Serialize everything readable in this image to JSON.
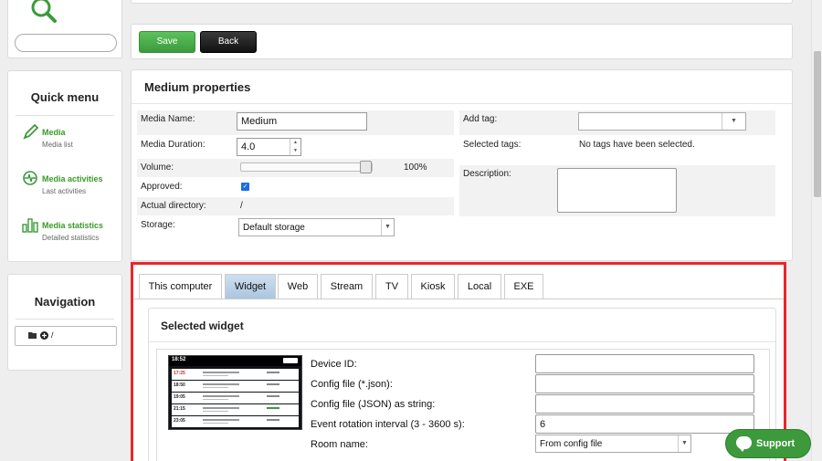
{
  "colors": {
    "accent_green": "#3c9a3c",
    "highlight_red": "#e8262c",
    "tab_active": "#aac6de"
  },
  "logo": {
    "icon": "search-icon"
  },
  "search": {
    "placeholder": ""
  },
  "quick_menu": {
    "title": "Quick menu",
    "items": [
      {
        "label": "Media",
        "sub": "Media list",
        "icon": "pencil-icon"
      },
      {
        "label": "Media activities",
        "sub": "Last activities",
        "icon": "activity-icon"
      },
      {
        "label": "Media statistics",
        "sub": "Detailed statistics",
        "icon": "bar-chart-icon"
      }
    ]
  },
  "navigation": {
    "title": "Navigation",
    "path": "/"
  },
  "toolbar": {
    "save_label": "Save",
    "back_label": "Back"
  },
  "properties": {
    "title": "Medium properties",
    "media_name_label": "Media Name:",
    "media_name_value": "Medium",
    "duration_label": "Media Duration:",
    "duration_value": "4.0",
    "volume_label": "Volume:",
    "volume_value": "100%",
    "volume_level": 1.0,
    "approved_label": "Approved:",
    "approved_checked": true,
    "directory_label": "Actual directory:",
    "directory_value": "/",
    "storage_label": "Storage:",
    "storage_value": "Default storage",
    "add_tag_label": "Add tag:",
    "selected_tags_label": "Selected tags:",
    "selected_tags_value": "No tags have been selected.",
    "description_label": "Description:"
  },
  "tabs": [
    {
      "label": "This computer",
      "active": false
    },
    {
      "label": "Widget",
      "active": true
    },
    {
      "label": "Web",
      "active": false
    },
    {
      "label": "Stream",
      "active": false
    },
    {
      "label": "TV",
      "active": false
    },
    {
      "label": "Kiosk",
      "active": false
    },
    {
      "label": "Local",
      "active": false
    },
    {
      "label": "EXE",
      "active": false
    }
  ],
  "widget": {
    "title": "Selected widget",
    "thumbnail": {
      "header_time": "18:52",
      "times": [
        "17:25",
        "18:50",
        "19:05",
        "21:15",
        "23:05"
      ]
    },
    "fields": [
      {
        "label": "Device ID:",
        "value": ""
      },
      {
        "label": "Config file (*.json):",
        "value": ""
      },
      {
        "label": "Config file (JSON) as string:",
        "value": ""
      },
      {
        "label": "Event rotation interval (3 - 3600 s):",
        "value": "6"
      },
      {
        "label": "Room name:",
        "value": "From config file"
      }
    ]
  },
  "support": {
    "label": "Support"
  }
}
